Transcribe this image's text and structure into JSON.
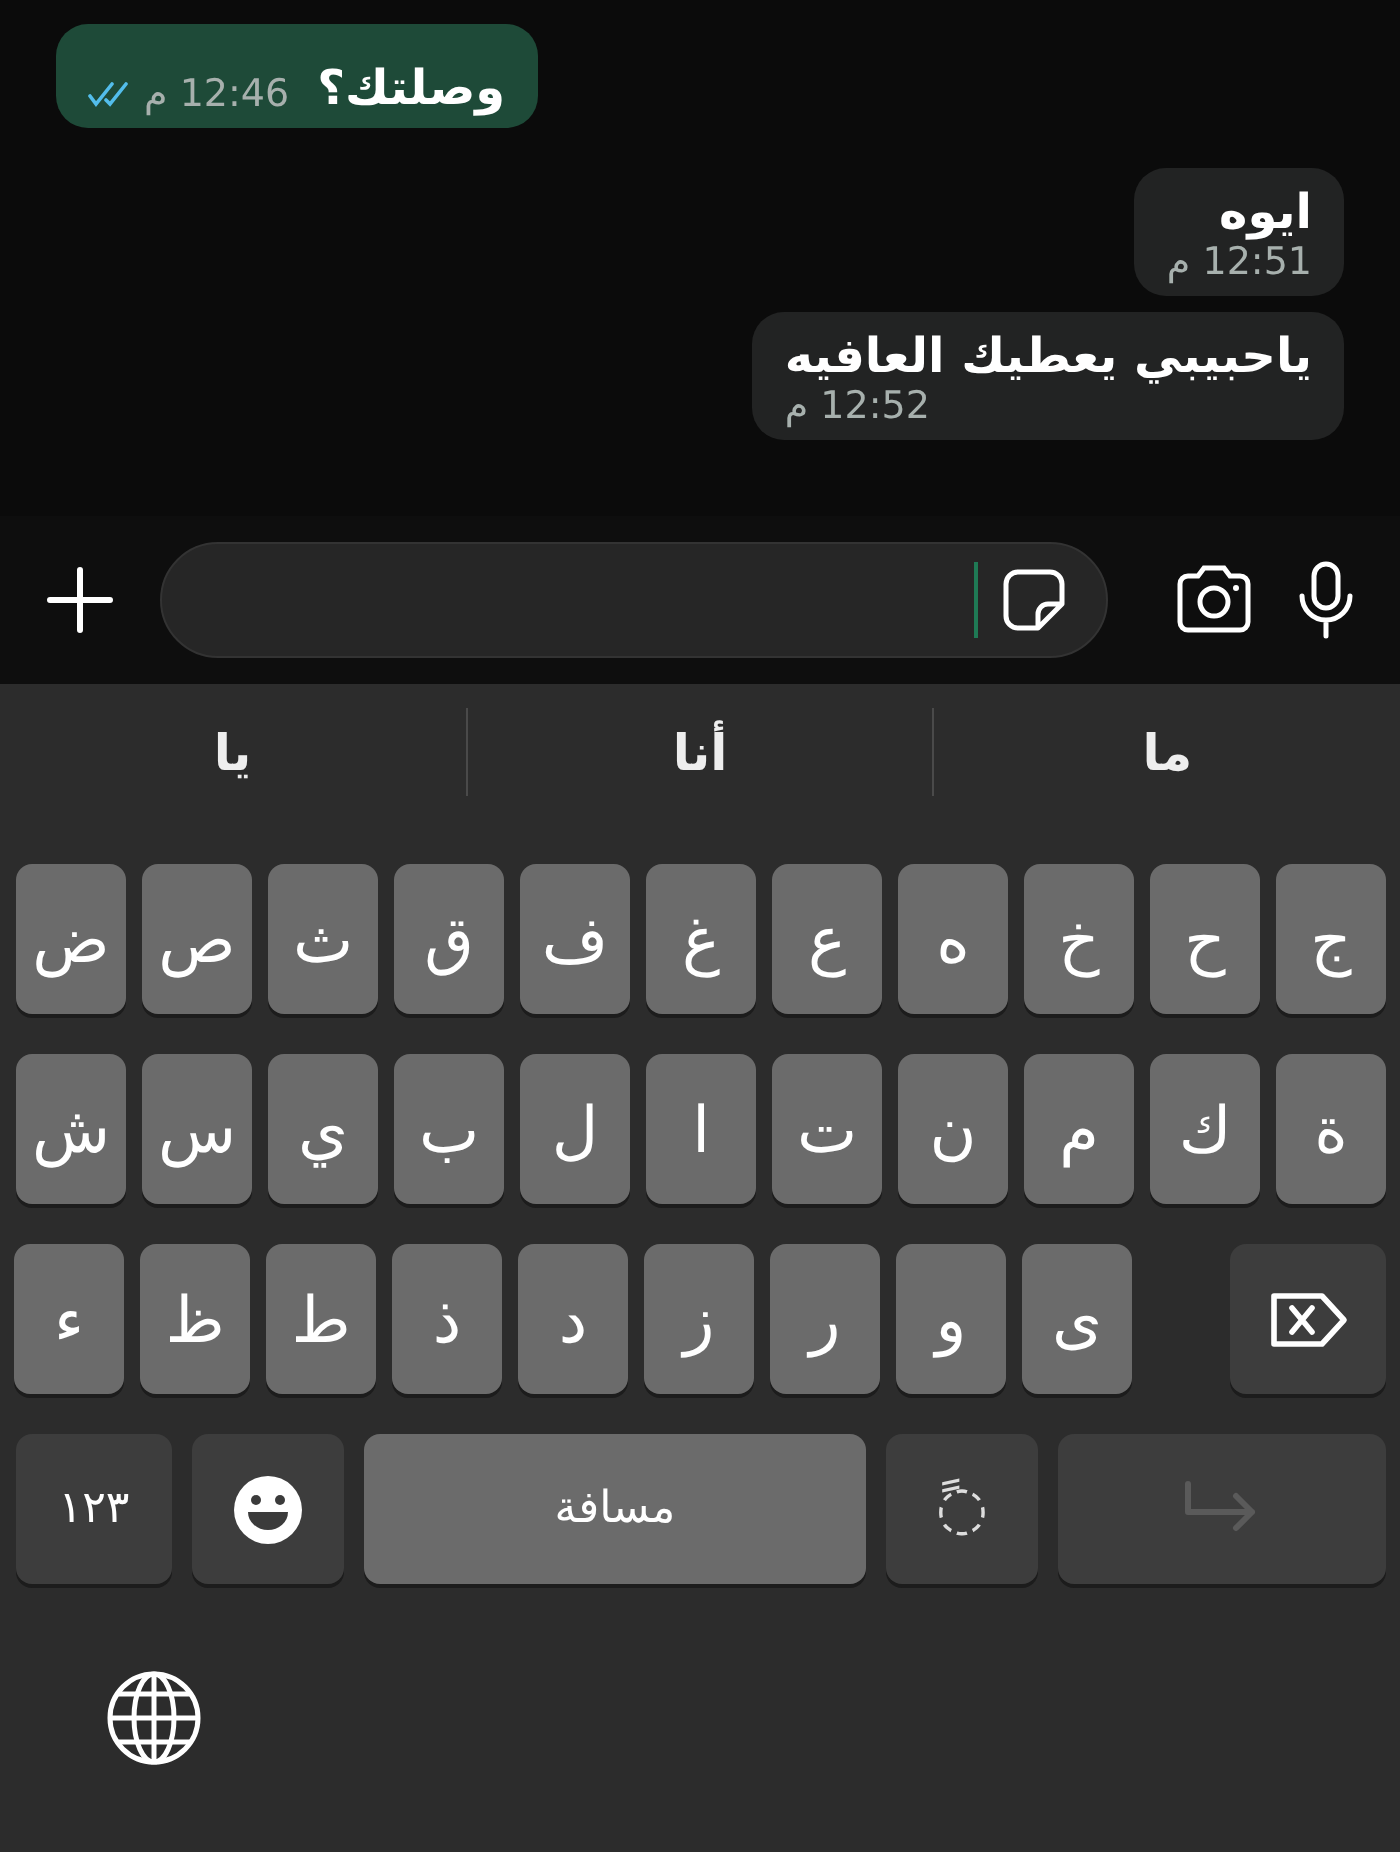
{
  "messages": [
    {
      "kind": "sent",
      "text": "وصلتك؟",
      "time": "12:46 م",
      "read": true
    },
    {
      "kind": "received",
      "text": "ايوه",
      "time": "12:51 م"
    },
    {
      "kind": "received",
      "text": "ياحبيبي يعطيك العافيه",
      "time": "12:52 م"
    }
  ],
  "suggestions": [
    "ما",
    "أنا",
    "يا"
  ],
  "keyboard": {
    "rows": [
      {
        "keys": [
          "ج",
          "ح",
          "خ",
          "ه",
          "ع",
          "غ",
          "ف",
          "ق",
          "ث",
          "ص",
          "ض"
        ],
        "backspace": false
      },
      {
        "keys": [
          "ة",
          "ك",
          "م",
          "ن",
          "ت",
          "ا",
          "ل",
          "ب",
          "ي",
          "س",
          "ش"
        ],
        "backspace": false
      },
      {
        "keys": [
          "ى",
          "و",
          "ر",
          "ز",
          "د",
          "ذ",
          "ط",
          "ظ",
          "ء"
        ],
        "backspace": true
      }
    ],
    "bottom_row": [
      {
        "kind": "return",
        "disabled": true
      },
      {
        "kind": "diacritic",
        "label": "◌ً"
      },
      {
        "kind": "space",
        "label": "مسافة"
      },
      {
        "kind": "emoji"
      },
      {
        "kind": "numbers",
        "label": "١٢٣"
      }
    ]
  }
}
